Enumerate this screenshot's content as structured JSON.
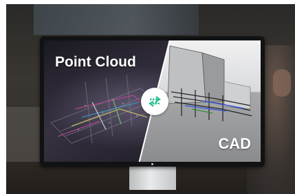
{
  "screen": {
    "left_label": "Point Cloud",
    "right_label": "CAD"
  },
  "icons": {
    "sync": "sync-arrows-icon"
  },
  "colors": {
    "accent": "#1fbf8f",
    "label": "#ffffff",
    "cad_background": "#d9dadc"
  }
}
